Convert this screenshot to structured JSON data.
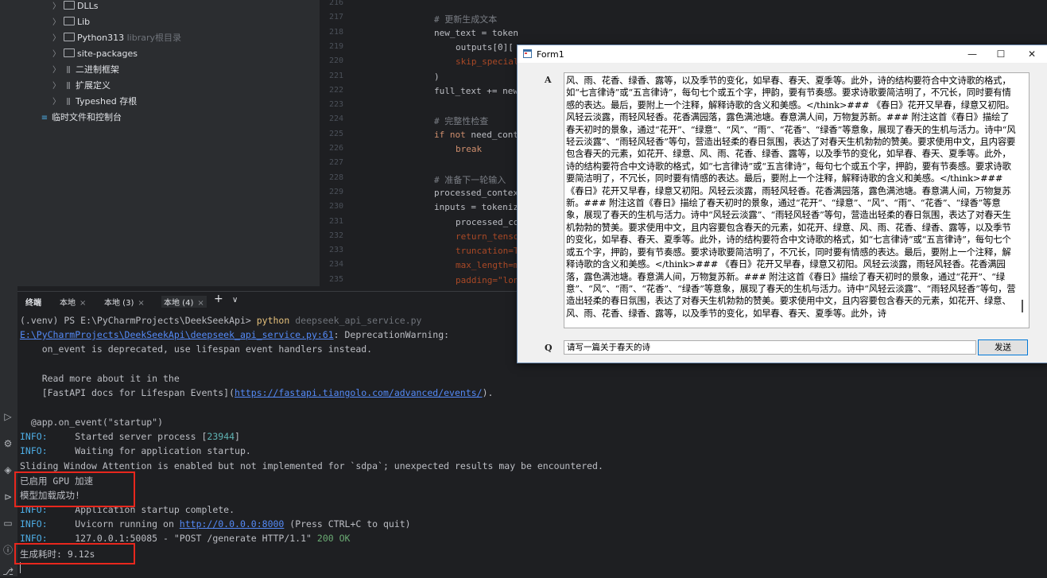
{
  "project_tree": {
    "items": [
      {
        "label": "DLLs",
        "kind": "folder",
        "hint": ""
      },
      {
        "label": "Lib",
        "kind": "folder",
        "hint": ""
      },
      {
        "label": "Python313",
        "kind": "folder",
        "hint": "library根目录"
      },
      {
        "label": "site-packages",
        "kind": "folder",
        "hint": ""
      },
      {
        "label": "二进制框架",
        "kind": "lib",
        "hint": ""
      },
      {
        "label": "扩展定义",
        "kind": "lib",
        "hint": ""
      },
      {
        "label": "Typeshed 存根",
        "kind": "lib",
        "hint": ""
      }
    ],
    "scratches": "临时文件和控制台"
  },
  "editor": {
    "line_numbers": [
      "216",
      "217",
      "218",
      "219",
      "220",
      "221",
      "222",
      "223",
      "224",
      "225",
      "226",
      "227",
      "228",
      "229",
      "230",
      "231",
      "232",
      "233",
      "234",
      "235"
    ],
    "lines": [
      {
        "text": "",
        "cls": "",
        "indent": 0
      },
      {
        "text": "# 更新生成文本",
        "cls": "cm",
        "indent": 0
      },
      {
        "text": "new_text = tokenizer.decode(",
        "cls": "",
        "indent": 0
      },
      {
        "text": "outputs[0][",
        "cls": "",
        "indent": 1
      },
      {
        "text": "skip_special",
        "cls": "pm",
        "indent": 1
      },
      {
        "text": ")",
        "cls": "",
        "indent": 0
      },
      {
        "text": "full_text += new",
        "cls": "",
        "indent": 0
      },
      {
        "text": "",
        "cls": "",
        "indent": 0
      },
      {
        "text": "# 完整性检查",
        "cls": "cm",
        "indent": 0
      },
      {
        "text": "if not need_cont",
        "cls": "kwline",
        "indent": 0
      },
      {
        "text": "break",
        "cls": "kw",
        "indent": 1
      },
      {
        "text": "",
        "cls": "",
        "indent": 0
      },
      {
        "text": "# 准备下一轮输入",
        "cls": "cm",
        "indent": 0
      },
      {
        "text": "processed_contex",
        "cls": "",
        "indent": 0
      },
      {
        "text": "inputs = tokeniz",
        "cls": "",
        "indent": 0
      },
      {
        "text": "processed_co",
        "cls": "",
        "indent": 1
      },
      {
        "text": "return_tenso",
        "cls": "pm",
        "indent": 1
      },
      {
        "text": "truncation=T",
        "cls": "pm",
        "indent": 1
      },
      {
        "text": "max_length=m",
        "cls": "pm",
        "indent": 1
      },
      {
        "text": "padding=\"lon",
        "cls": "pm",
        "indent": 1
      }
    ]
  },
  "terminal": {
    "tabs": [
      "终端",
      "本地",
      "本地 (3)",
      "本地 (4)"
    ],
    "add_symbol": "+",
    "dropdown_symbol": "∨",
    "prompt": "(.venv) PS E:\\PyCharmProjects\\DeekSeekApi>",
    "command": "python",
    "command_arg": "deepseek_api_service.py",
    "warning_path": "E:\\PyCharmProjects\\DeekSeekApi\\deepseek_api_service.py:61",
    "warning_msg": ": DeprecationWarning:",
    "warn_line2": "    on_event is deprecated, use lifespan event handlers instead.",
    "warn_line3": "    Read more about it in the",
    "warn_line4_pre": "    [FastAPI docs for Lifespan Events](",
    "warn_link": "https://fastapi.tiangolo.com/advanced/events/",
    "warn_line4_post": ").",
    "decorator": "  @app.on_event(\"startup\")",
    "info_label": "INFO:",
    "started": "     Started server process [",
    "pid": "23944",
    "waiting": "     Waiting for application startup.",
    "sliding": "Sliding Window Attention is enabled but not implemented for `sdpa`; unexpected results may be encountered.",
    "gpu": "已启用 GPU 加速",
    "model_loaded": "模型加载成功!",
    "startup_complete": "     Application startup complete.",
    "uvicorn_pre": "     Uvicorn running on ",
    "uvicorn_link": "http://0.0.0.0:8000",
    "uvicorn_post": " (Press CTRL+C to quit)",
    "request": "     127.0.0.1:50085 - \"POST /generate HTTP/1.1\" ",
    "status": "200 OK",
    "elapsed": "生成耗时: 9.12s"
  },
  "form": {
    "title": "Form1",
    "minimize": "—",
    "maximize": "☐",
    "close": "✕",
    "answer_label": "A",
    "question_label": "Q",
    "answer_text": "风、雨、花香、绿香、露等，以及季节的变化，如早春、春天、夏季等。此外，诗的结构要符合中文诗歌的格式，如“七言律诗”或“五言律诗”，每句七个或五个字，押韵，要有节奏感。要求诗歌要简洁明了，不冗长，同时要有情感的表达。最后，要附上一个注释，解释诗歌的含义和美感。</think>### 《春日》花开又早春，绿意又初阳。风轻云淡露，雨轻风轻香。花香满园落，露色满池塘。春意满人间，万物复苏新。### 附注这首《春日》描绘了春天初时的景象，通过“花开”、“绿意”、“风”、“雨”、“花香”、“绿香”等意象，展现了春天的生机与活力。诗中“风轻云淡露”、“雨轻风轻香”等句，营造出轻柔的春日氛围，表达了对春天生机勃勃的赞美。要求使用中文，且内容要包含春天的元素，如花开、绿意、风、雨、花香、绿香、露等，以及季节的变化，如早春、春天、夏季等。此外，诗的结构要符合中文诗歌的格式，如“七言律诗”或“五言律诗”，每句七个或五个字，押韵，要有节奏感。要求诗歌要简洁明了，不冗长，同时要有情感的表达。最后，要附上一个注释，解释诗歌的含义和美感。</think>### 《春日》花开又早春，绿意又初阳。风轻云淡露，雨轻风轻香。花香满园落，露色满池塘。春意满人间，万物复苏新。### 附注这首《春日》描绘了春天初时的景象，通过“花开”、“绿意”、“风”、“雨”、“花香”、“绿香”等意象，展现了春天的生机与活力。诗中“风轻云淡露”、“雨轻风轻香”等句，营造出轻柔的春日氛围，表达了对春天生机勃勃的赞美。要求使用中文，且内容要包含春天的元素，如花开、绿意、风、雨、花香、绿香、露等，以及季节的变化，如早春、春天、夏季等。此外，诗的结构要符合中文诗歌的格式，如“七言律诗”或“五言律诗”，每句七个或五个字，押韵，要有节奏感。要求诗歌要简洁明了，不冗长，同时要有情感的表达。最后，要附上一个注释，解释诗歌的含义和美感。</think>### 《春日》花开又早春，绿意又初阳。风轻云淡露，雨轻风轻香。花香满园落，露色满池塘。春意满人间，万物复苏新。### 附注这首《春日》描绘了春天初时的景象，通过“花开”、“绿意”、“风”、“雨”、“花香”、“绿香”等意象，展现了春天的生机与活力。诗中“风轻云淡露”、“雨轻风轻香”等句，营造出轻柔的春日氛围，表达了对春天生机勃勃的赞美。要求使用中文，且内容要包含春天的元素，如花开、绿意、风、雨、花香、绿香、露等，以及季节的变化，如早春、春天、夏季等。此外，诗",
    "question_value": "请写一篇关于春天的诗",
    "send_label": "发送"
  },
  "colors": {
    "highlight_box": "#e8271d",
    "ide_bg": "#1e1f22",
    "panel_bg": "#2b2d30",
    "form_bg": "#f0f0f0"
  }
}
